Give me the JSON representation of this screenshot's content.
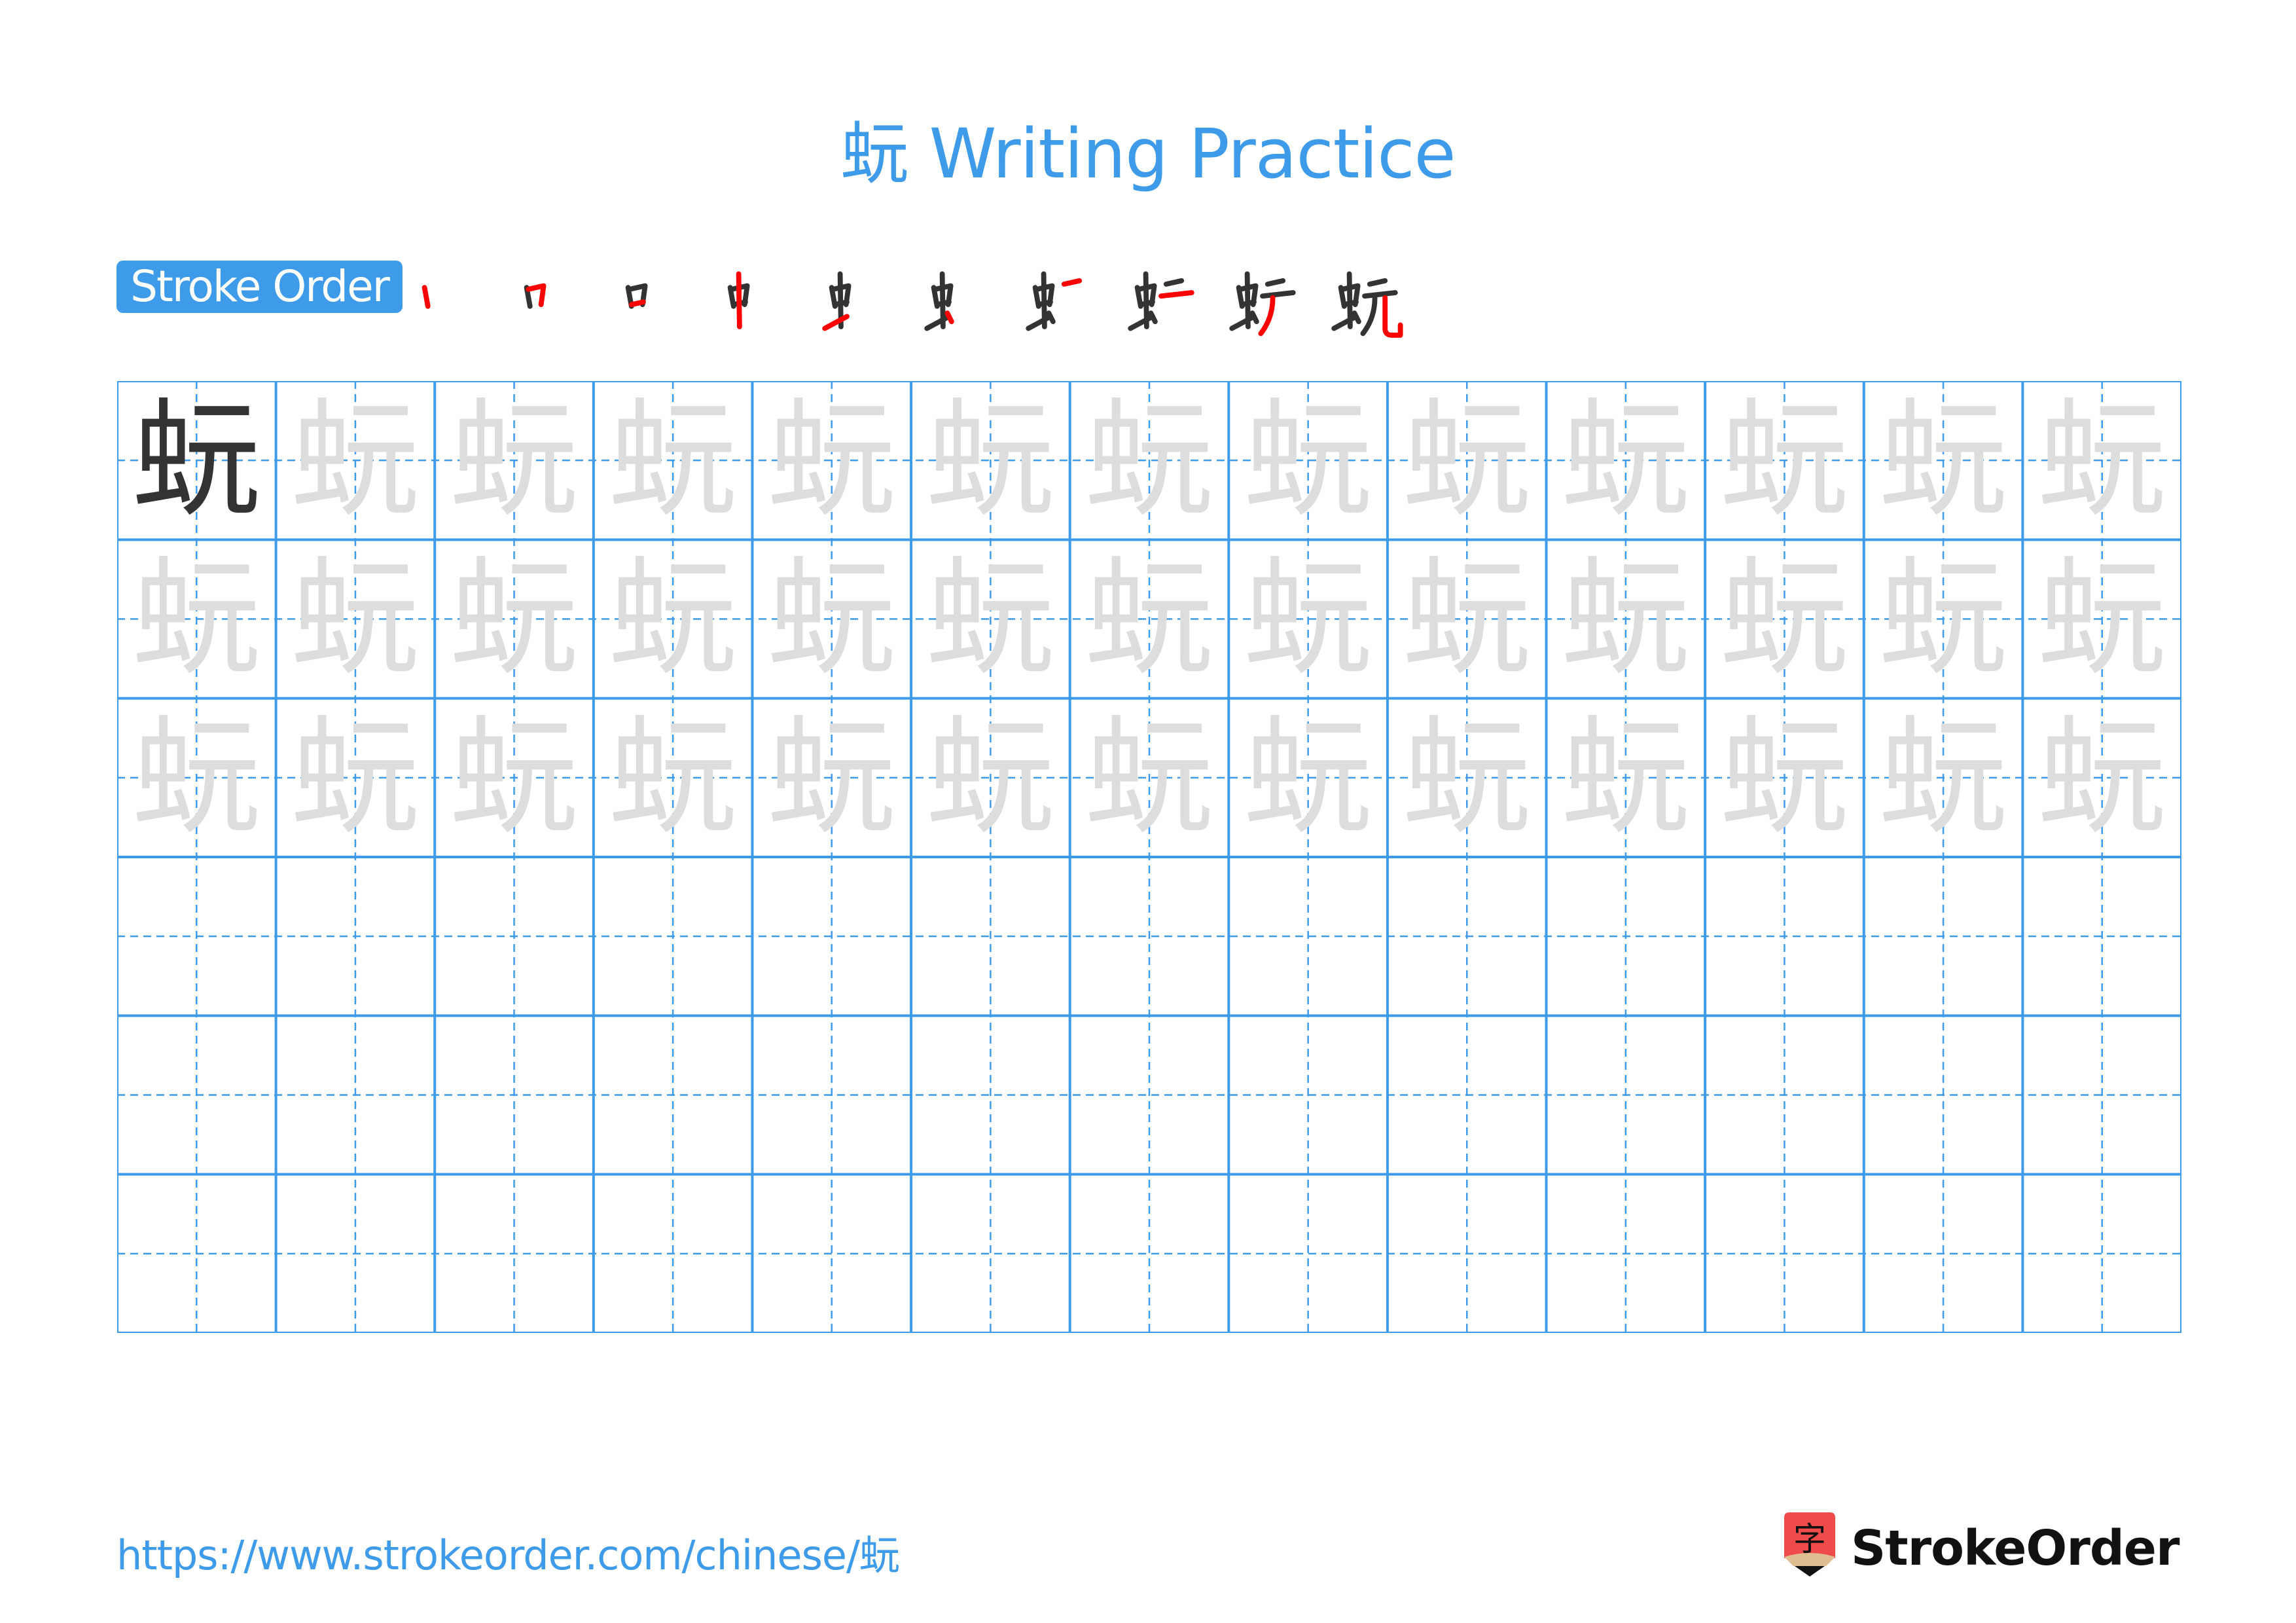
{
  "page": {
    "title": "蚖 Writing Practice",
    "character": "蚖"
  },
  "stroke_order": {
    "label": "Stroke Order",
    "step_count": 10,
    "highlight_color": "#ff0000",
    "done_color": "#333333"
  },
  "grid": {
    "rows": 6,
    "columns": 13,
    "line_color": "#3d9be9",
    "model_color": "#333333",
    "trace_color": "#dddddd",
    "traced_rows": 3
  },
  "footer": {
    "url": "https://www.strokeorder.com/chinese/蚖",
    "brand_name": "StrokeOrder",
    "brand_icon_glyph": "字",
    "brand_icon": "pencil-logo-icon"
  }
}
